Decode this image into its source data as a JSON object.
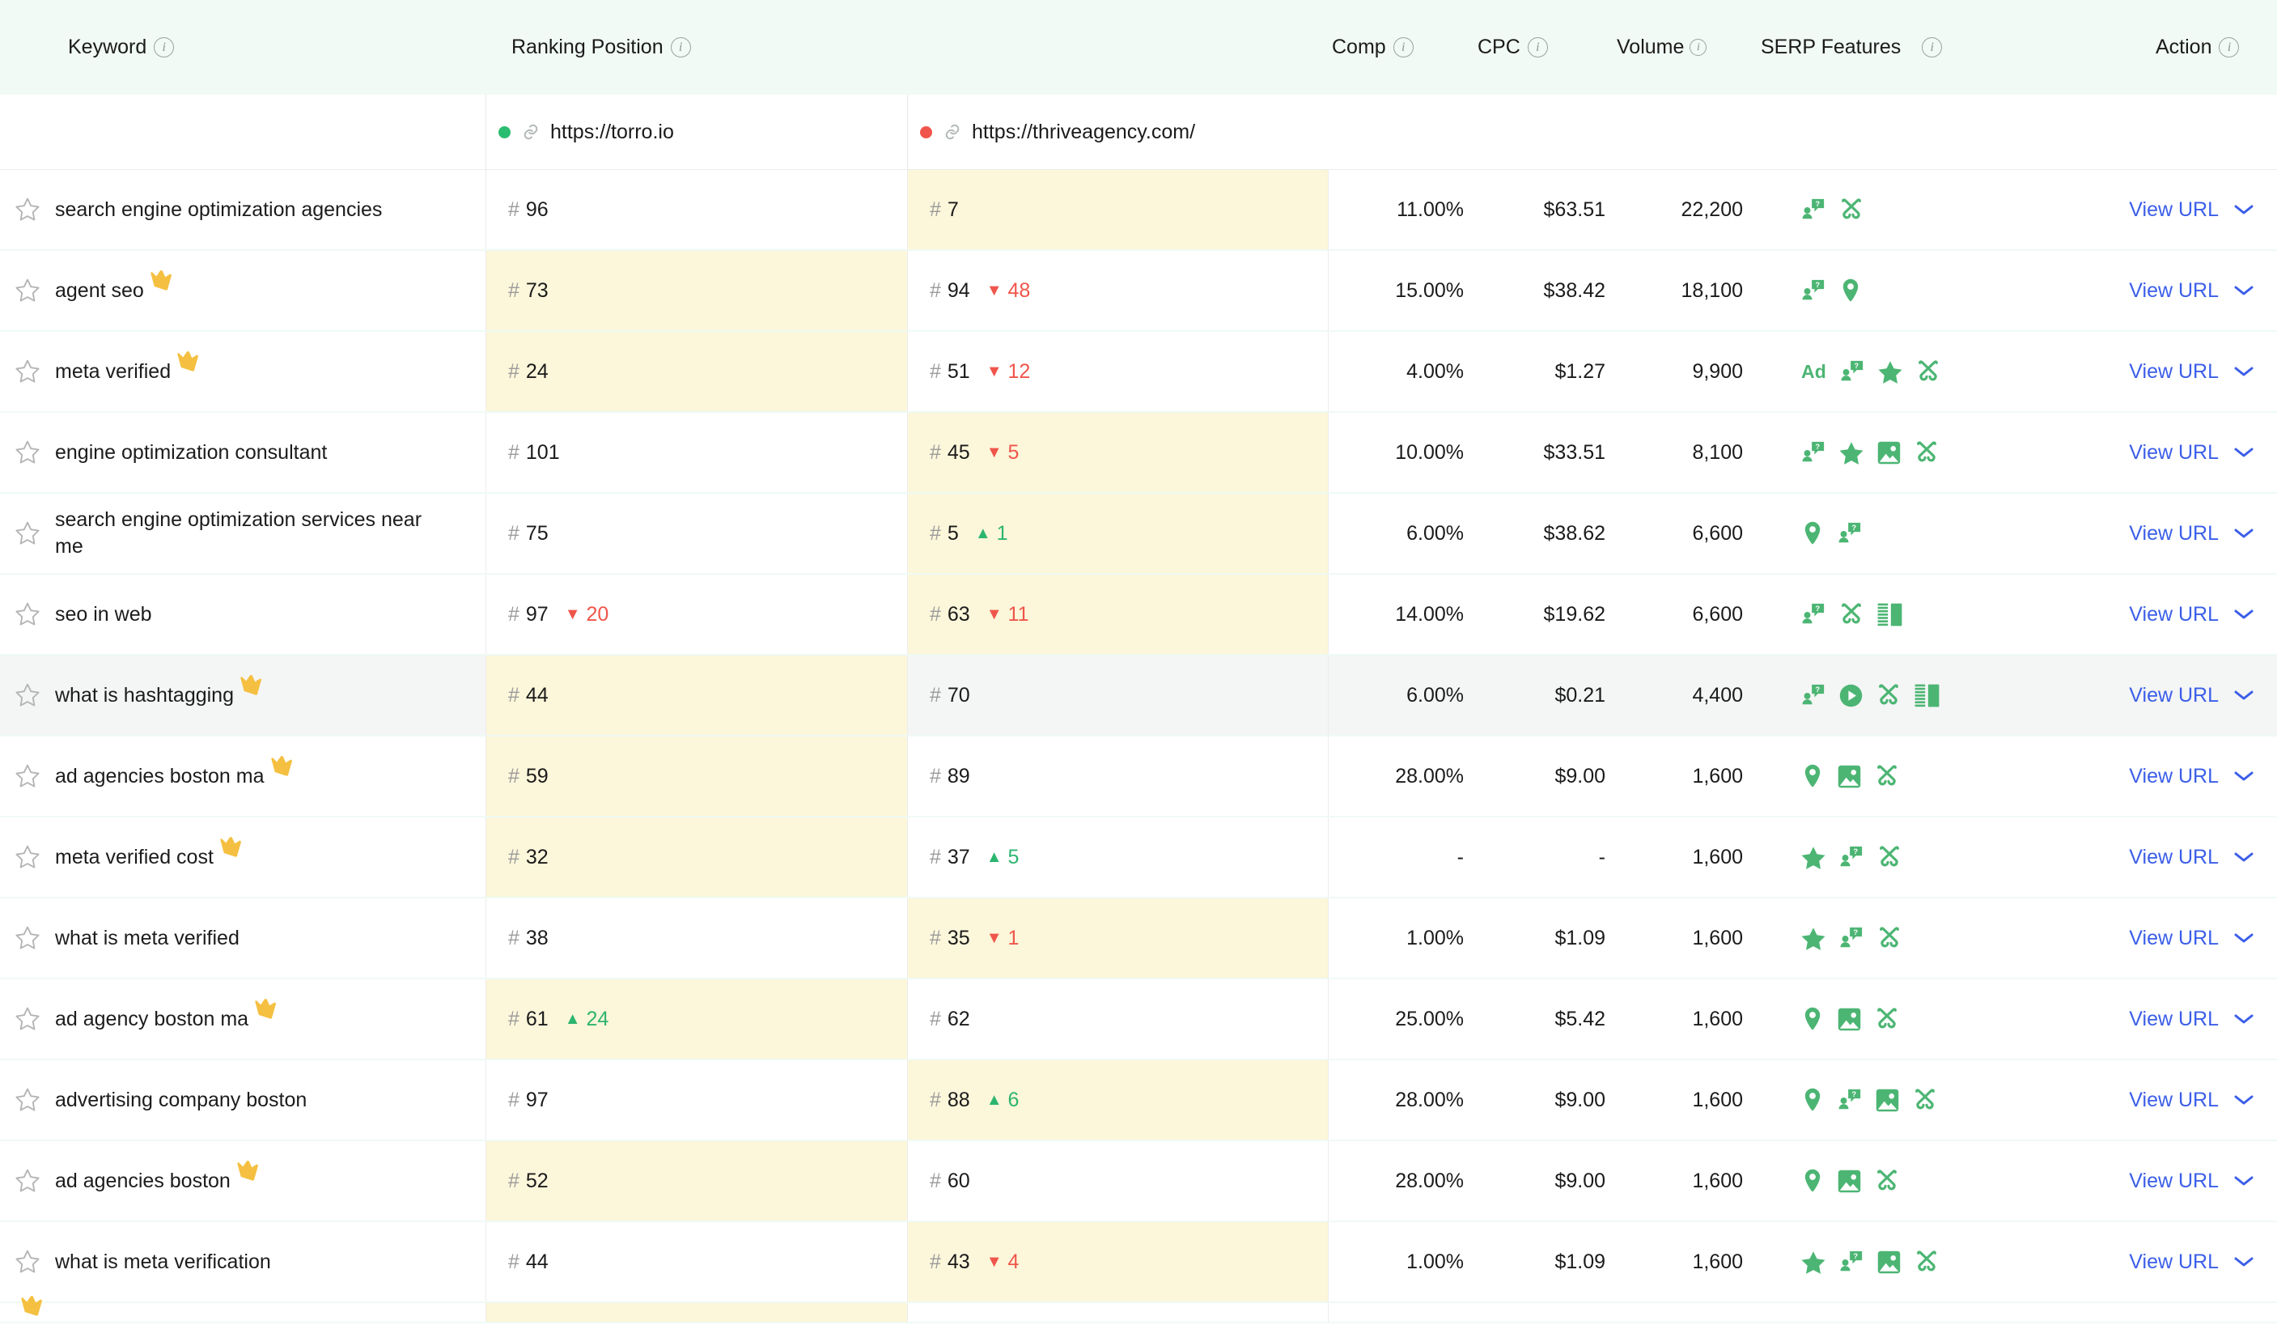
{
  "header": {
    "columns": [
      {
        "label": "Keyword",
        "info": true
      },
      {
        "label": "Ranking Position",
        "info": true
      },
      {
        "label": "Comp",
        "info": true
      },
      {
        "label": "CPC",
        "info": true
      },
      {
        "label": "Volume",
        "info": true
      },
      {
        "label": "SERP Features",
        "info": true
      },
      {
        "label": "Action",
        "info": true
      }
    ],
    "info_glyph": "i"
  },
  "sites": [
    {
      "url": "https://torro.io",
      "status": "green",
      "status_color": "#2bbd6f"
    },
    {
      "url": "https://thriveagency.com/",
      "status": "red",
      "status_color": "#f0544a"
    }
  ],
  "action_label": "View URL",
  "colors": {
    "header_bg": "#f1faf5",
    "highlight_cell": "#fcf6da",
    "hover_row": "#f4f5f5",
    "row_divider": "#effaf4",
    "link": "#3b5ee8",
    "serp_icon": "#4cb573",
    "delta_down": "#f0554b",
    "delta_up": "#2cb56f",
    "crown": "#f5c041",
    "hash": "#9b9b9b"
  },
  "rows": [
    {
      "keyword": "search engine optimization agencies",
      "crown": false,
      "hover": false,
      "rank0": {
        "hash": "#",
        "value": "96",
        "delta": null,
        "dir": null,
        "highlight": false
      },
      "rank1": {
        "hash": "#",
        "value": "7",
        "delta": null,
        "dir": null,
        "highlight": true
      },
      "comp": "11.00%",
      "cpc": "$63.51",
      "volume": "22,200",
      "serp": [
        "people-also-ask",
        "sitelinks"
      ],
      "action": "View URL"
    },
    {
      "keyword": "agent seo",
      "crown": true,
      "hover": false,
      "rank0": {
        "hash": "#",
        "value": "73",
        "delta": null,
        "dir": null,
        "highlight": true
      },
      "rank1": {
        "hash": "#",
        "value": "94",
        "delta": "48",
        "dir": "down",
        "highlight": false
      },
      "comp": "15.00%",
      "cpc": "$38.42",
      "volume": "18,100",
      "serp": [
        "people-also-ask",
        "local-pack"
      ],
      "action": "View URL"
    },
    {
      "keyword": "meta verified",
      "crown": true,
      "hover": false,
      "rank0": {
        "hash": "#",
        "value": "24",
        "delta": null,
        "dir": null,
        "highlight": true
      },
      "rank1": {
        "hash": "#",
        "value": "51",
        "delta": "12",
        "dir": "down",
        "highlight": false
      },
      "comp": "4.00%",
      "cpc": "$1.27",
      "volume": "9,900",
      "serp": [
        "ad",
        "people-also-ask",
        "reviews",
        "sitelinks"
      ],
      "action": "View URL"
    },
    {
      "keyword": "engine optimization consultant",
      "crown": false,
      "hover": false,
      "rank0": {
        "hash": "#",
        "value": "101",
        "delta": null,
        "dir": null,
        "highlight": false
      },
      "rank1": {
        "hash": "#",
        "value": "45",
        "delta": "5",
        "dir": "down",
        "highlight": true
      },
      "comp": "10.00%",
      "cpc": "$33.51",
      "volume": "8,100",
      "serp": [
        "people-also-ask",
        "reviews",
        "image",
        "sitelinks"
      ],
      "action": "View URL"
    },
    {
      "keyword": "search engine optimization services near me",
      "crown": false,
      "hover": false,
      "rank0": {
        "hash": "#",
        "value": "75",
        "delta": null,
        "dir": null,
        "highlight": false
      },
      "rank1": {
        "hash": "#",
        "value": "5",
        "delta": "1",
        "dir": "up",
        "highlight": true
      },
      "comp": "6.00%",
      "cpc": "$38.62",
      "volume": "6,600",
      "serp": [
        "local-pack",
        "people-also-ask"
      ],
      "action": "View URL"
    },
    {
      "keyword": "seo in web",
      "crown": false,
      "hover": false,
      "rank0": {
        "hash": "#",
        "value": "97",
        "delta": "20",
        "dir": "down",
        "highlight": false
      },
      "rank1": {
        "hash": "#",
        "value": "63",
        "delta": "11",
        "dir": "down",
        "highlight": true
      },
      "comp": "14.00%",
      "cpc": "$19.62",
      "volume": "6,600",
      "serp": [
        "people-also-ask",
        "sitelinks",
        "knowledge-panel"
      ],
      "action": "View URL"
    },
    {
      "keyword": "what is hashtagging",
      "crown": true,
      "hover": true,
      "rank0": {
        "hash": "#",
        "value": "44",
        "delta": null,
        "dir": null,
        "highlight": true
      },
      "rank1": {
        "hash": "#",
        "value": "70",
        "delta": null,
        "dir": null,
        "highlight": false
      },
      "comp": "6.00%",
      "cpc": "$0.21",
      "volume": "4,400",
      "serp": [
        "people-also-ask",
        "video",
        "sitelinks",
        "knowledge-panel"
      ],
      "action": "View URL"
    },
    {
      "keyword": "ad agencies boston ma",
      "crown": true,
      "hover": false,
      "rank0": {
        "hash": "#",
        "value": "59",
        "delta": null,
        "dir": null,
        "highlight": true
      },
      "rank1": {
        "hash": "#",
        "value": "89",
        "delta": null,
        "dir": null,
        "highlight": false
      },
      "comp": "28.00%",
      "cpc": "$9.00",
      "volume": "1,600",
      "serp": [
        "local-pack",
        "image",
        "sitelinks"
      ],
      "action": "View URL"
    },
    {
      "keyword": "meta verified cost",
      "crown": true,
      "hover": false,
      "rank0": {
        "hash": "#",
        "value": "32",
        "delta": null,
        "dir": null,
        "highlight": true
      },
      "rank1": {
        "hash": "#",
        "value": "37",
        "delta": "5",
        "dir": "up",
        "highlight": false
      },
      "comp": "-",
      "cpc": "-",
      "volume": "1,600",
      "serp": [
        "reviews",
        "people-also-ask",
        "sitelinks"
      ],
      "action": "View URL"
    },
    {
      "keyword": "what is meta verified",
      "crown": false,
      "hover": false,
      "rank0": {
        "hash": "#",
        "value": "38",
        "delta": null,
        "dir": null,
        "highlight": false
      },
      "rank1": {
        "hash": "#",
        "value": "35",
        "delta": "1",
        "dir": "down",
        "highlight": true
      },
      "comp": "1.00%",
      "cpc": "$1.09",
      "volume": "1,600",
      "serp": [
        "reviews",
        "people-also-ask",
        "sitelinks"
      ],
      "action": "View URL"
    },
    {
      "keyword": "ad agency boston ma",
      "crown": true,
      "hover": false,
      "rank0": {
        "hash": "#",
        "value": "61",
        "delta": "24",
        "dir": "up",
        "highlight": true
      },
      "rank1": {
        "hash": "#",
        "value": "62",
        "delta": null,
        "dir": null,
        "highlight": false
      },
      "comp": "25.00%",
      "cpc": "$5.42",
      "volume": "1,600",
      "serp": [
        "local-pack",
        "image",
        "sitelinks"
      ],
      "action": "View URL"
    },
    {
      "keyword": "advertising company boston",
      "crown": false,
      "hover": false,
      "rank0": {
        "hash": "#",
        "value": "97",
        "delta": null,
        "dir": null,
        "highlight": false
      },
      "rank1": {
        "hash": "#",
        "value": "88",
        "delta": "6",
        "dir": "up",
        "highlight": true
      },
      "comp": "28.00%",
      "cpc": "$9.00",
      "volume": "1,600",
      "serp": [
        "local-pack",
        "people-also-ask",
        "image",
        "sitelinks"
      ],
      "action": "View URL"
    },
    {
      "keyword": "ad agencies boston",
      "crown": true,
      "hover": false,
      "rank0": {
        "hash": "#",
        "value": "52",
        "delta": null,
        "dir": null,
        "highlight": true
      },
      "rank1": {
        "hash": "#",
        "value": "60",
        "delta": null,
        "dir": null,
        "highlight": false
      },
      "comp": "28.00%",
      "cpc": "$9.00",
      "volume": "1,600",
      "serp": [
        "local-pack",
        "image",
        "sitelinks"
      ],
      "action": "View URL"
    },
    {
      "keyword": "what is meta verification",
      "crown": false,
      "hover": false,
      "rank0": {
        "hash": "#",
        "value": "44",
        "delta": null,
        "dir": null,
        "highlight": false
      },
      "rank1": {
        "hash": "#",
        "value": "43",
        "delta": "4",
        "dir": "down",
        "highlight": true
      },
      "comp": "1.00%",
      "cpc": "$1.09",
      "volume": "1,600",
      "serp": [
        "reviews",
        "people-also-ask",
        "image",
        "sitelinks"
      ],
      "action": "View URL"
    },
    {
      "keyword": "",
      "crown": true,
      "hover": false,
      "partial": true,
      "rank0": {
        "hash": "",
        "value": "",
        "delta": null,
        "dir": null,
        "highlight": true
      },
      "rank1": {
        "hash": "",
        "value": "",
        "delta": null,
        "dir": null,
        "highlight": false
      },
      "comp": "",
      "cpc": "",
      "volume": "",
      "serp": [],
      "action": ""
    }
  ]
}
